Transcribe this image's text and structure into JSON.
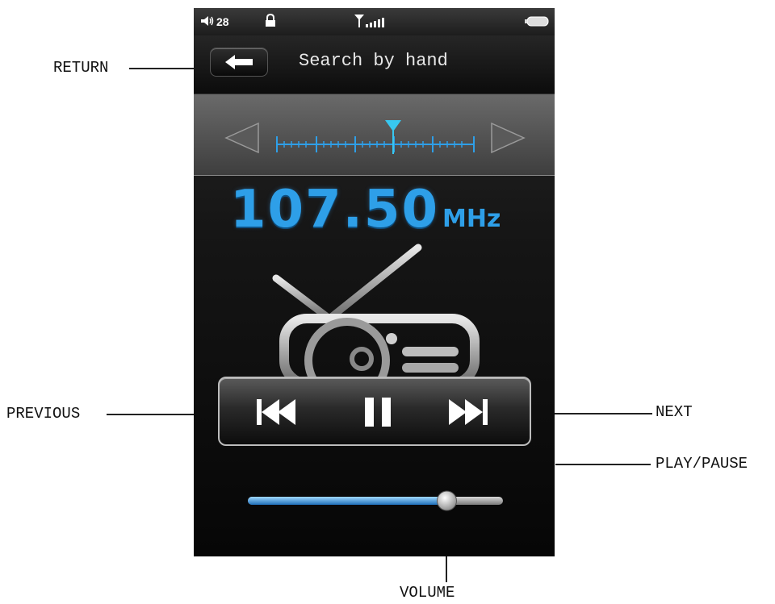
{
  "callouts": {
    "return": "RETURN",
    "previous": "PREVIOUS",
    "next": "NEXT",
    "play_pause": "PLAY/PAUSE",
    "volume": "VOLUME"
  },
  "status_bar": {
    "volume_level": "28",
    "icons": [
      "speaker-icon",
      "lock-icon",
      "antenna-signal-icon",
      "battery-icon"
    ]
  },
  "header": {
    "title": "Search by hand",
    "back_icon": "arrow-left-icon"
  },
  "tuner": {
    "frequency": "107.50",
    "unit": "MHz",
    "icons": [
      "tune-left-icon",
      "tune-right-icon",
      "tuner-marker-icon"
    ]
  },
  "playback": {
    "icons": [
      "previous-icon",
      "pause-icon",
      "next-icon"
    ]
  },
  "volume": {
    "level": 0.78
  },
  "colors": {
    "accent": "#2e9fe8",
    "background": "#0a0a0a"
  }
}
